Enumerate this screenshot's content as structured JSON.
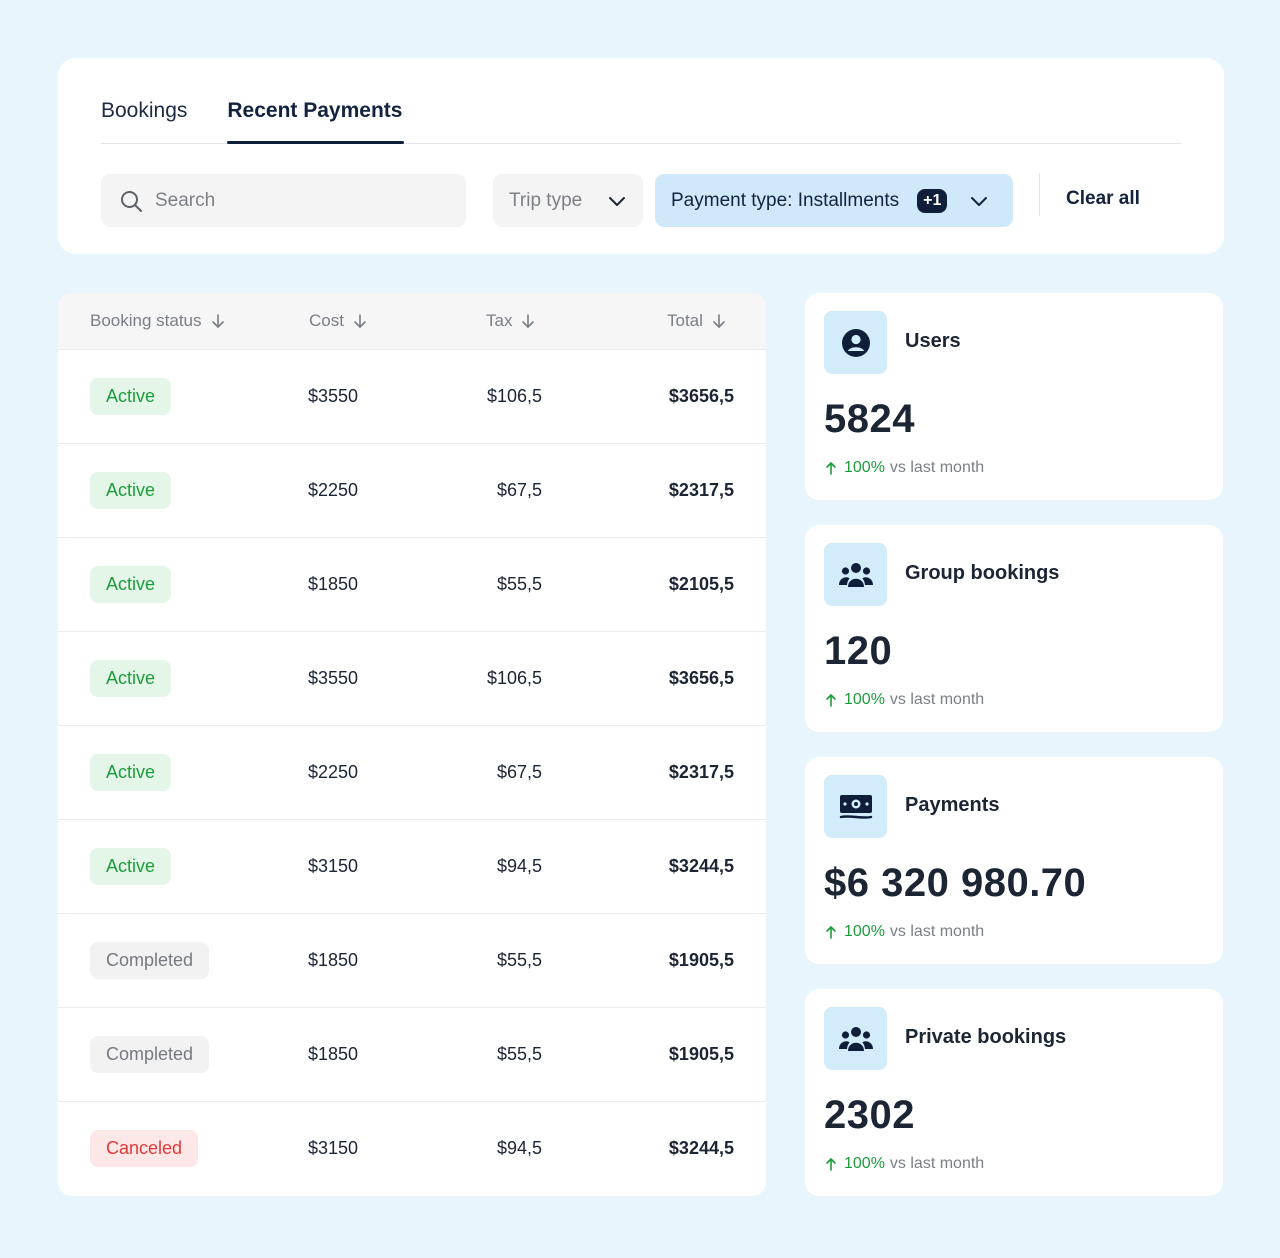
{
  "tabs": [
    {
      "label": "Bookings",
      "active": false
    },
    {
      "label": "Recent Payments",
      "active": true
    }
  ],
  "search": {
    "placeholder": "Search",
    "value": ""
  },
  "filters": {
    "trip_type": {
      "label": "Trip type"
    },
    "payment_type": {
      "label": "Payment type: Installments",
      "badge": "+1"
    },
    "clear_all": "Clear all"
  },
  "table": {
    "headers": [
      "Booking status",
      "Cost",
      "Tax",
      "Total"
    ],
    "rows": [
      {
        "status": "Active",
        "status_kind": "active",
        "cost": "$3550",
        "tax": "$106,5",
        "total": "$3656,5"
      },
      {
        "status": "Active",
        "status_kind": "active",
        "cost": "$2250",
        "tax": "$67,5",
        "total": "$2317,5"
      },
      {
        "status": "Active",
        "status_kind": "active",
        "cost": "$1850",
        "tax": "$55,5",
        "total": "$2105,5"
      },
      {
        "status": "Active",
        "status_kind": "active",
        "cost": "$3550",
        "tax": "$106,5",
        "total": "$3656,5"
      },
      {
        "status": "Active",
        "status_kind": "active",
        "cost": "$2250",
        "tax": "$67,5",
        "total": "$2317,5"
      },
      {
        "status": "Active",
        "status_kind": "active",
        "cost": "$3150",
        "tax": "$94,5",
        "total": "$3244,5"
      },
      {
        "status": "Completed",
        "status_kind": "completed",
        "cost": "$1850",
        "tax": "$55,5",
        "total": "$1905,5"
      },
      {
        "status": "Completed",
        "status_kind": "completed",
        "cost": "$1850",
        "tax": "$55,5",
        "total": "$1905,5"
      },
      {
        "status": "Canceled",
        "status_kind": "canceled",
        "cost": "$3150",
        "tax": "$94,5",
        "total": "$3244,5"
      }
    ]
  },
  "stats": [
    {
      "icon": "user-icon",
      "title": "Users",
      "value": "5824",
      "trend_pct": "100%",
      "trend_text": "vs last month"
    },
    {
      "icon": "group-icon",
      "title": "Group bookings",
      "value": "120",
      "trend_pct": "100%",
      "trend_text": "vs last month"
    },
    {
      "icon": "money-icon",
      "title": "Payments",
      "value": "$6 320 980.70",
      "trend_pct": "100%",
      "trend_text": "vs last month"
    },
    {
      "icon": "group-icon",
      "title": "Private bookings",
      "value": "2302",
      "trend_pct": "100%",
      "trend_text": "vs last month"
    }
  ],
  "colors": {
    "accent": "#0f1f3a",
    "active": "#1d9c3b",
    "canceled": "#e23a3a",
    "chip_blue": "#cfe9fb",
    "page_bg": "#e9f5fd"
  }
}
